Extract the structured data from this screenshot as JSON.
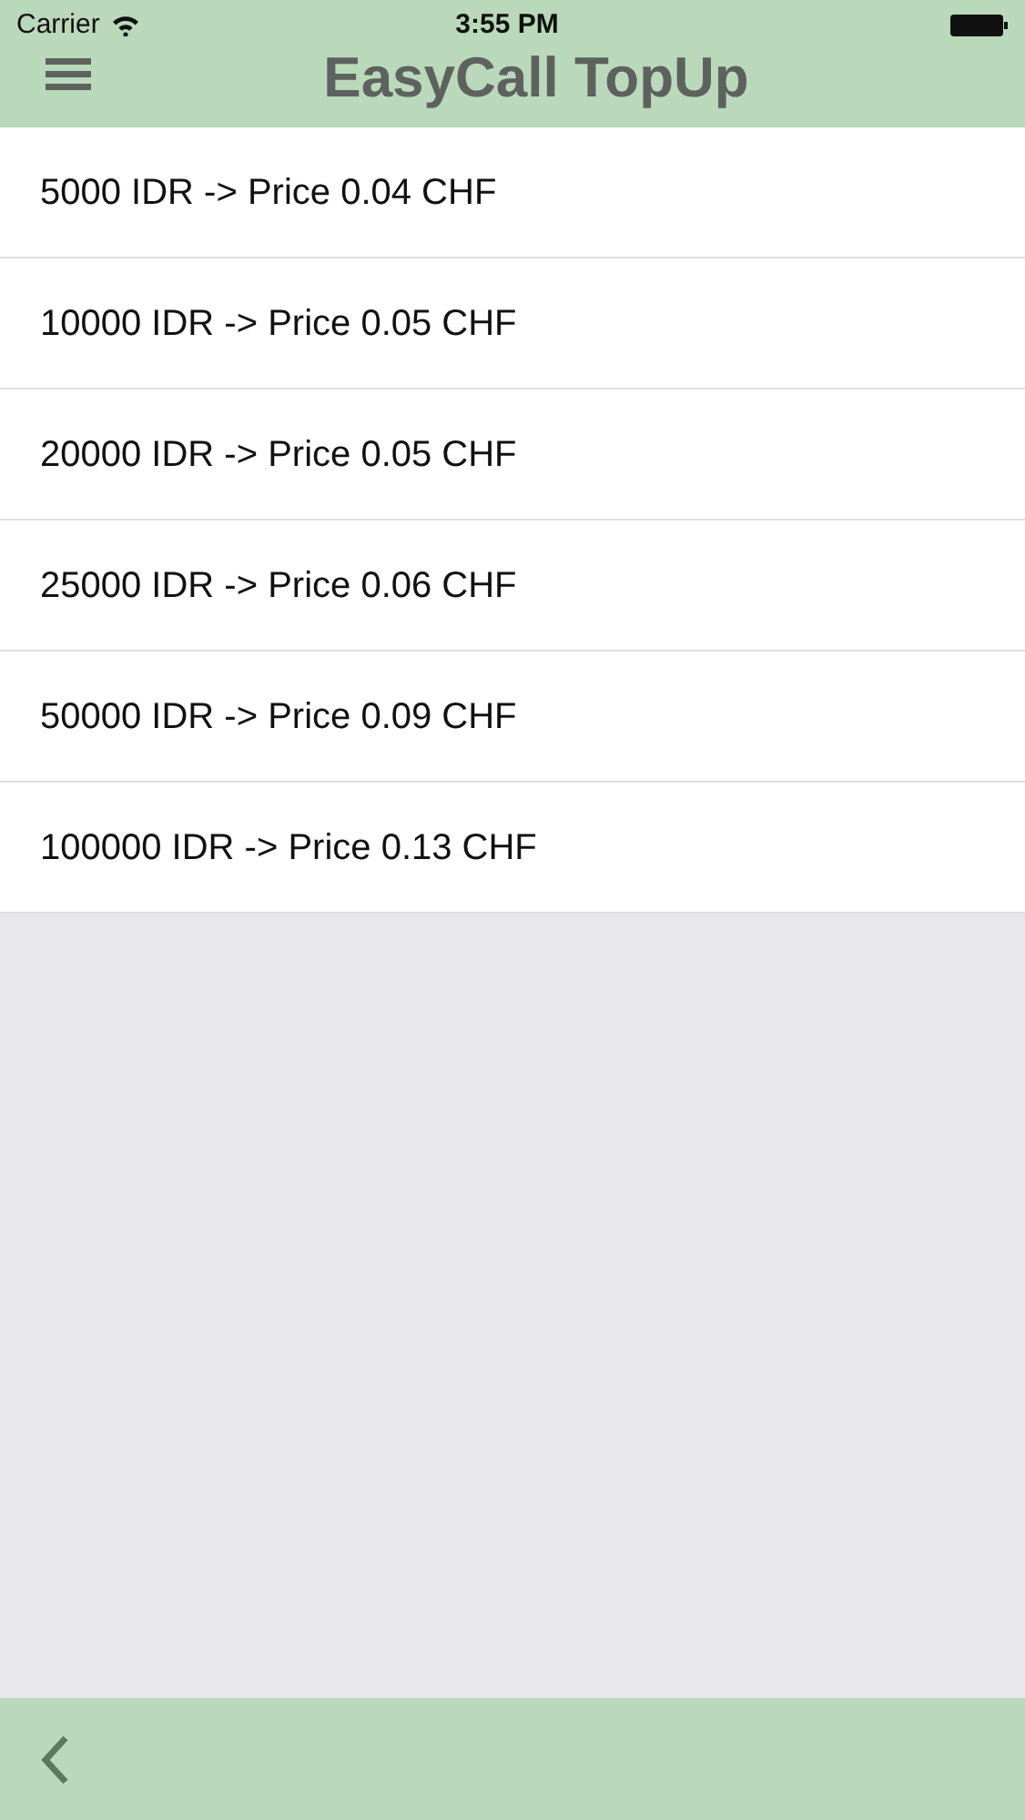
{
  "status_bar": {
    "carrier": "Carrier",
    "time": "3:55 PM"
  },
  "nav_bar": {
    "title": "EasyCall TopUp"
  },
  "items": [
    {
      "label": "5000 IDR -> Price 0.04 CHF"
    },
    {
      "label": "10000 IDR -> Price 0.05 CHF"
    },
    {
      "label": "20000 IDR -> Price 0.05 CHF"
    },
    {
      "label": "25000 IDR -> Price 0.06 CHF"
    },
    {
      "label": "50000 IDR -> Price 0.09 CHF"
    },
    {
      "label": "100000 IDR -> Price 0.13 CHF"
    }
  ]
}
